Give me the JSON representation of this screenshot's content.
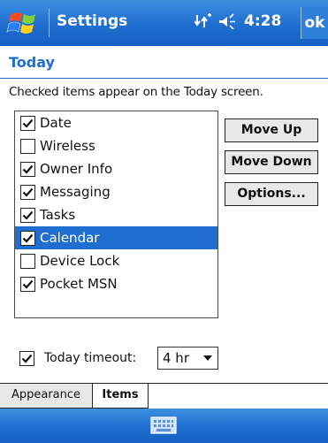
{
  "titlebar": {
    "title": "Settings",
    "time": "4:28",
    "ok_label": "ok",
    "icons": {
      "start": "windows-flag-icon",
      "connectivity": "connectivity-arrows-icon",
      "volume": "speaker-icon"
    }
  },
  "page": {
    "title": "Today",
    "instructions": "Checked items appear on the Today screen."
  },
  "list": {
    "items": [
      {
        "label": "Date",
        "checked": true,
        "selected": false
      },
      {
        "label": "Wireless",
        "checked": false,
        "selected": false
      },
      {
        "label": "Owner Info",
        "checked": true,
        "selected": false
      },
      {
        "label": "Messaging",
        "checked": true,
        "selected": false
      },
      {
        "label": "Tasks",
        "checked": true,
        "selected": false
      },
      {
        "label": "Calendar",
        "checked": true,
        "selected": true
      },
      {
        "label": "Device Lock",
        "checked": false,
        "selected": false
      },
      {
        "label": "Pocket MSN",
        "checked": true,
        "selected": false
      }
    ]
  },
  "buttons": {
    "move_up": "Move Up",
    "move_down": "Move Down",
    "options": "Options..."
  },
  "timeout": {
    "checked": true,
    "label": "Today timeout:",
    "value": "4 hr"
  },
  "tabs": [
    {
      "label": "Appearance",
      "active": false
    },
    {
      "label": "Items",
      "active": true
    }
  ],
  "command_bar": {
    "icon": "keyboard-icon"
  },
  "colors": {
    "accent": "#1f6ed0",
    "selection": "#1f6ed0"
  }
}
